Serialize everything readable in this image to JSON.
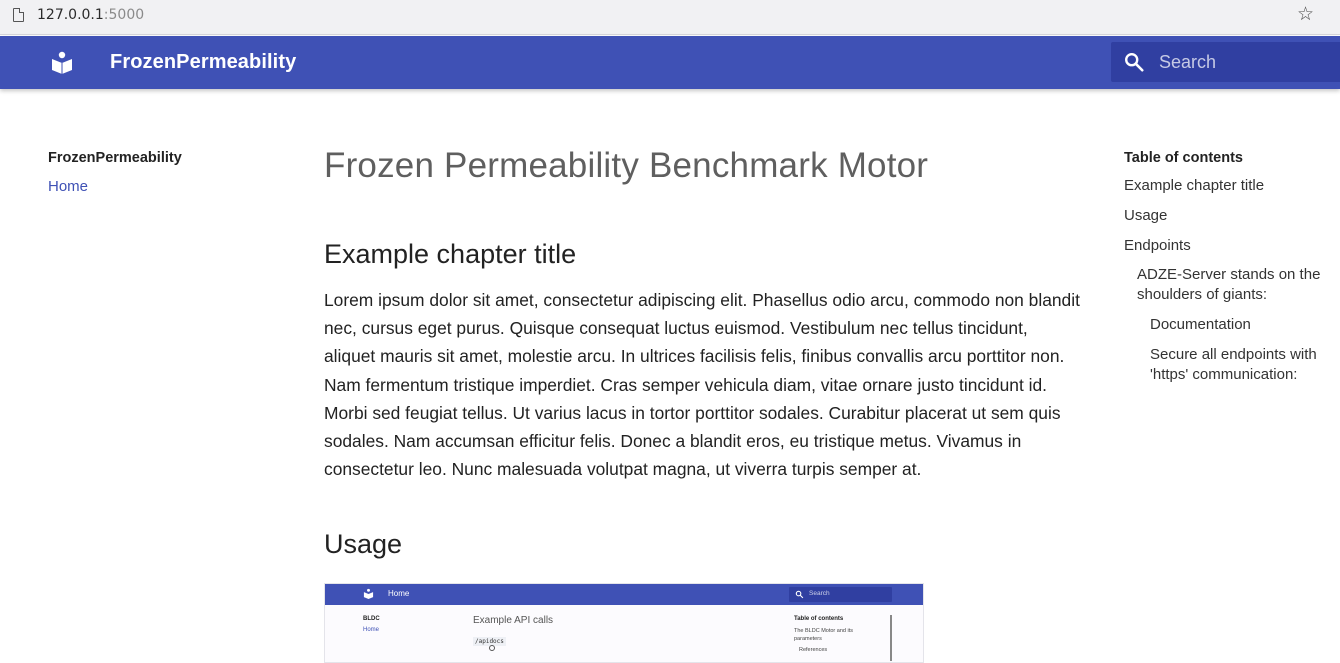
{
  "browser": {
    "url_host": "127.0.0.1",
    "url_port": ":5000"
  },
  "header": {
    "site_title": "FrozenPermeability",
    "search_placeholder": "Search"
  },
  "left_nav": {
    "title": "FrozenPermeability",
    "items": [
      {
        "label": "Home"
      }
    ]
  },
  "main": {
    "title": "Frozen Permeability Benchmark Motor",
    "sections": [
      {
        "heading": "Example chapter title",
        "body": "Lorem ipsum dolor sit amet, consectetur adipiscing elit. Phasellus odio arcu, commodo non blandit nec, cursus eget purus. Quisque consequat luctus euismod. Vestibulum nec tellus tincidunt, aliquet mauris sit amet, molestie arcu. In ultrices facilisis felis, finibus convallis arcu porttitor non. Nam fermentum tristique imperdiet. Cras semper vehicula diam, vitae ornare justo tincidunt id. Morbi sed feugiat tellus. Ut varius lacus in tortor porttitor sodales. Curabitur placerat ut sem quis sodales. Nam accumsan efficitur felis. Donec a blandit eros, eu tristique metus. Vivamus in consectetur leo. Nunc malesuada volutpat magna, ut viverra turpis semper at."
      },
      {
        "heading": "Usage"
      }
    ],
    "screenshot": {
      "header_home": "Home",
      "search_placeholder": "Search",
      "nav_title": "BLDC",
      "nav_link": "Home",
      "heading": "Example API calls",
      "code": "/apidocs",
      "toc_title": "Table of contents",
      "toc_item_1": "The BLDC Motor and its parameters",
      "toc_item_2": "References"
    }
  },
  "toc": {
    "title": "Table of contents",
    "items": [
      {
        "label": "Example chapter title"
      },
      {
        "label": "Usage"
      },
      {
        "label": "Endpoints"
      },
      {
        "label": "ADZE-Server stands on the shoulders of giants:"
      },
      {
        "label": "Documentation"
      },
      {
        "label": "Secure all endpoints with 'https' communication:"
      }
    ]
  },
  "colors": {
    "primary": "#3f51b5",
    "search_bg": "#303fa1",
    "link": "#3f51b5"
  }
}
